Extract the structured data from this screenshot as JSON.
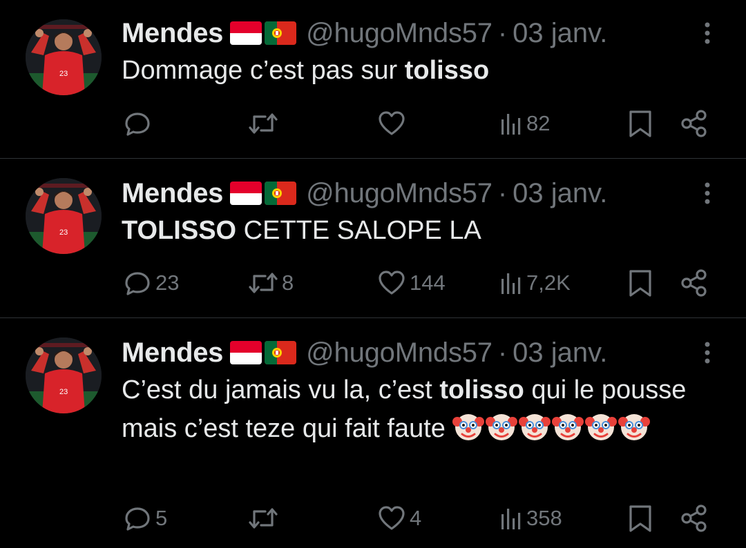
{
  "colors": {
    "background": "#000000",
    "text_primary": "#e7e9ea",
    "text_secondary": "#71767b",
    "divider": "#2f3336"
  },
  "tweets": [
    {
      "author": {
        "name": "Mendes",
        "flags": [
          "flag-monaco-icon",
          "flag-portugal-icon"
        ],
        "handle": "@hugoMnds57",
        "separator": "·",
        "date": "03 janv."
      },
      "text_segments": [
        {
          "text": "Dommage c’est pas sur ",
          "bold": false
        },
        {
          "text": "tolisso",
          "bold": true
        }
      ],
      "emojis": [],
      "stats": {
        "replies": "",
        "reposts": "",
        "likes": "",
        "views": "82"
      }
    },
    {
      "author": {
        "name": "Mendes",
        "flags": [
          "flag-monaco-icon",
          "flag-portugal-icon"
        ],
        "handle": "@hugoMnds57",
        "separator": "·",
        "date": "03 janv."
      },
      "text_segments": [
        {
          "text": "TOLISSO",
          "bold": true
        },
        {
          "text": " CETTE SALOPE LA",
          "bold": false
        }
      ],
      "emojis": [],
      "stats": {
        "replies": "23",
        "reposts": "8",
        "likes": "144",
        "views": "7,2K"
      }
    },
    {
      "author": {
        "name": "Mendes",
        "flags": [
          "flag-monaco-icon",
          "flag-portugal-icon"
        ],
        "handle": "@hugoMnds57",
        "separator": "·",
        "date": "03 janv."
      },
      "text_segments": [
        {
          "text": "C’est du jamais vu la, c’est ",
          "bold": false
        },
        {
          "text": "tolisso",
          "bold": true
        },
        {
          "text": " qui le pousse mais c’est teze qui fait faute ",
          "bold": false
        }
      ],
      "emojis": [
        "clown-face-icon",
        "clown-face-icon",
        "clown-face-icon",
        "clown-face-icon",
        "clown-face-icon",
        "clown-face-icon"
      ],
      "stats": {
        "replies": "5",
        "reposts": "",
        "likes": "4",
        "views": "358"
      }
    }
  ]
}
